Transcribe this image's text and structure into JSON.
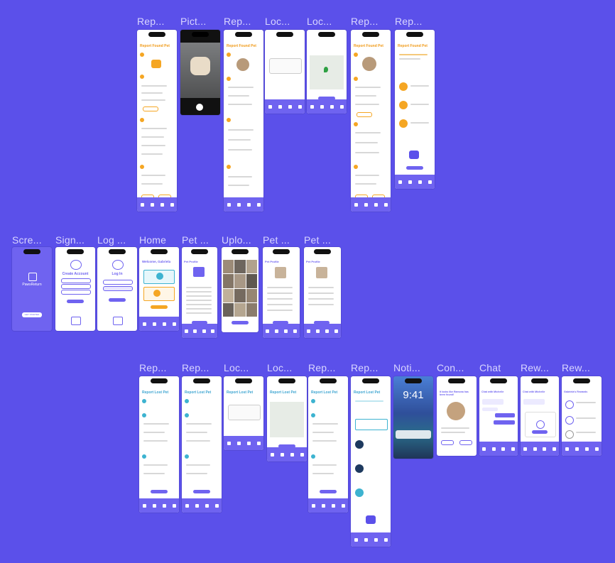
{
  "labels": {
    "row1": [
      "Rep...",
      "Pict...",
      "Rep...",
      "Loc...",
      "Loc...",
      "Rep...",
      "Rep..."
    ],
    "row2": [
      "Scre...",
      "Sign...",
      "Log ...",
      "Home",
      "Pet ...",
      "Uplo...",
      "Pet ...",
      "Pet ..."
    ],
    "row3": [
      "Rep...",
      "Rep...",
      "Loc...",
      "Loc...",
      "Rep...",
      "Rep...",
      "Noti...",
      "Con...",
      "Chat",
      "Rew...",
      "Rew..."
    ]
  },
  "screens": {
    "report_found_title": "Report Found Pet",
    "report_lost_title": "Report Lost Pet",
    "splash_brand": "PawsReturn",
    "splash_button": "GET STARTED",
    "signup_title": "Create Account",
    "login_title": "Log In",
    "home_title": "Welcome, Gabriela",
    "pet_profile_title": "Pet Profile",
    "pet_name": "Ramona",
    "lock_time": "9:41",
    "match_title": "It looks like Ramona has been found!",
    "chat_title": "Chat with Michelle",
    "rewards_title": "Gabriela's Rewards"
  }
}
